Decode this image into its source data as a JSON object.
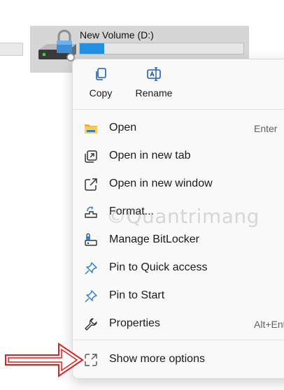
{
  "drive": {
    "name": "New Volume (D:)",
    "used_fraction": 0.15
  },
  "quick_actions": [
    {
      "label": "Copy",
      "icon": "copy-icon"
    },
    {
      "label": "Rename",
      "icon": "rename-icon"
    }
  ],
  "menu_items": [
    {
      "label": "Open",
      "shortcut": "Enter",
      "icon": "folder-icon"
    },
    {
      "label": "Open in new tab",
      "shortcut": "",
      "icon": "new-tab-icon"
    },
    {
      "label": "Open in new window",
      "shortcut": "",
      "icon": "new-window-icon"
    },
    {
      "label": "Format...",
      "shortcut": "",
      "icon": "format-icon"
    },
    {
      "label": "Manage BitLocker",
      "shortcut": "",
      "icon": "bitlocker-key-icon"
    },
    {
      "label": "Pin to Quick access",
      "shortcut": "",
      "icon": "pin-icon"
    },
    {
      "label": "Pin to Start",
      "shortcut": "",
      "icon": "pin-icon"
    },
    {
      "label": "Properties",
      "shortcut": "Alt+Enter",
      "icon": "wrench-icon"
    },
    {
      "label": "Show more options",
      "shortcut": "",
      "icon": "show-more-icon"
    }
  ],
  "watermark": "Quantrimang",
  "colors": {
    "accent": "#2690e0",
    "annotation_arrow": "#e02020"
  }
}
